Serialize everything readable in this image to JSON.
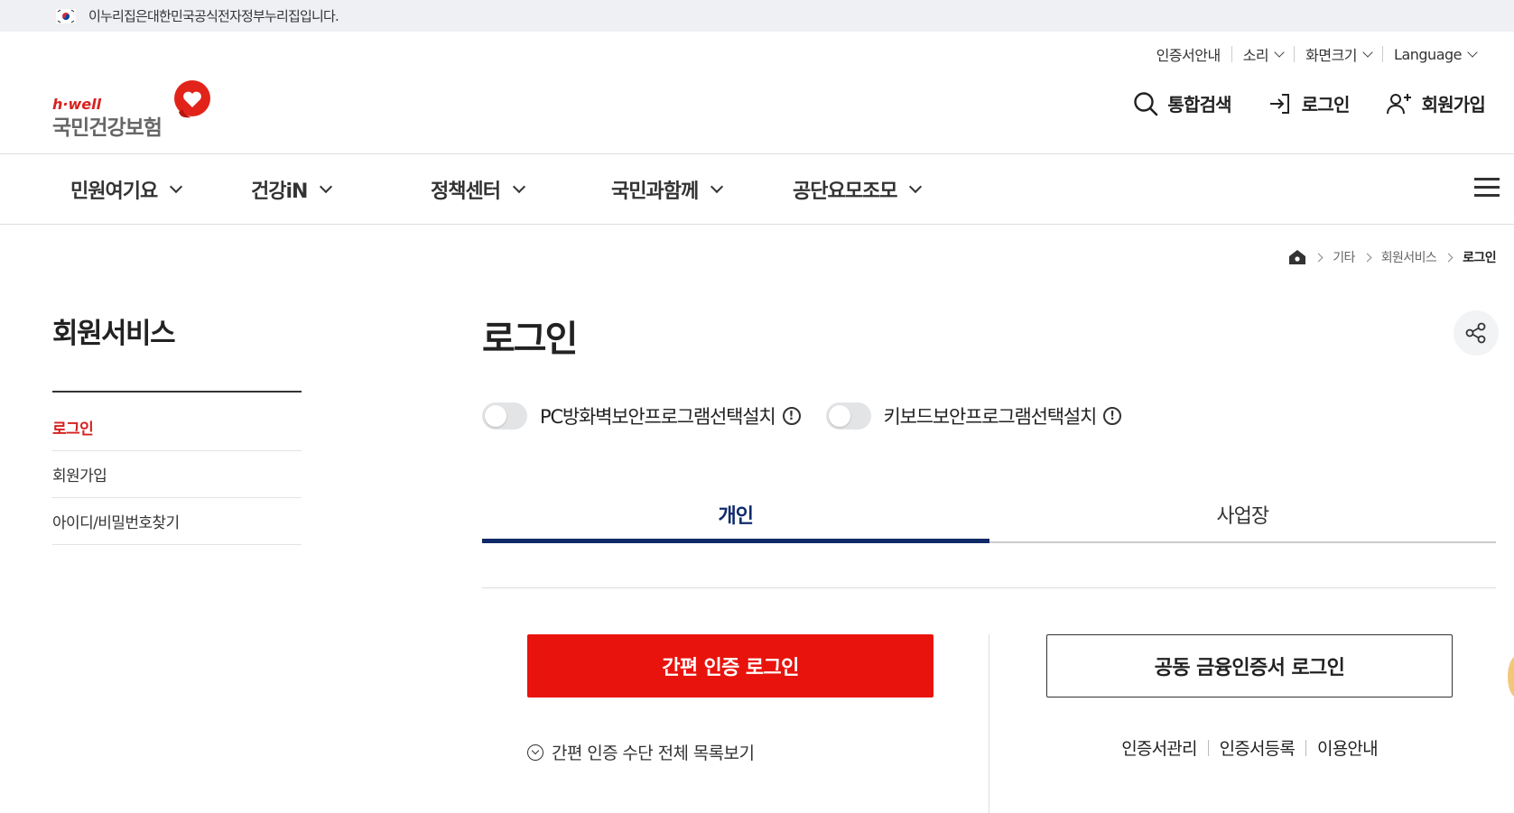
{
  "gov_banner": {
    "text": "이누리집은대한민국공식전자정부누리집입니다."
  },
  "utility": {
    "cert_guide": "인증서안내",
    "sound": "소리",
    "screen_size": "화면크기",
    "language": "Language"
  },
  "logo": {
    "brand": "h·well",
    "name": "국민건강보험"
  },
  "header_actions": {
    "search": "통합검색",
    "login": "로그인",
    "signup": "회원가입"
  },
  "gnb": {
    "items": [
      "민원여기요",
      "건강iN",
      "정책센터",
      "국민과함께",
      "공단요모조모"
    ]
  },
  "breadcrumb": {
    "items": [
      "기타",
      "회원서비스"
    ],
    "current": "로그인"
  },
  "sidebar": {
    "title": "회원서비스",
    "items": [
      "로그인",
      "회원가입",
      "아이디/비밀번호찾기"
    ]
  },
  "main": {
    "title": "로그인",
    "toggles": {
      "firewall": "PC방화벽보안프로그램선택설치",
      "keyboard": "키보드보안프로그램선택설치",
      "info_glyph": "!"
    },
    "tabs": [
      "개인",
      "사업장"
    ],
    "easy_login": "간편 인증 로그인",
    "easy_more": "간편 인증 수단 전체 목록보기",
    "cert_login": "공동 금융인증서 로그인",
    "cert_links": [
      "인증서관리",
      "인증서등록",
      "이용안내"
    ]
  },
  "colors": {
    "accent_red": "#e8130c",
    "navy": "#0f2a66"
  }
}
